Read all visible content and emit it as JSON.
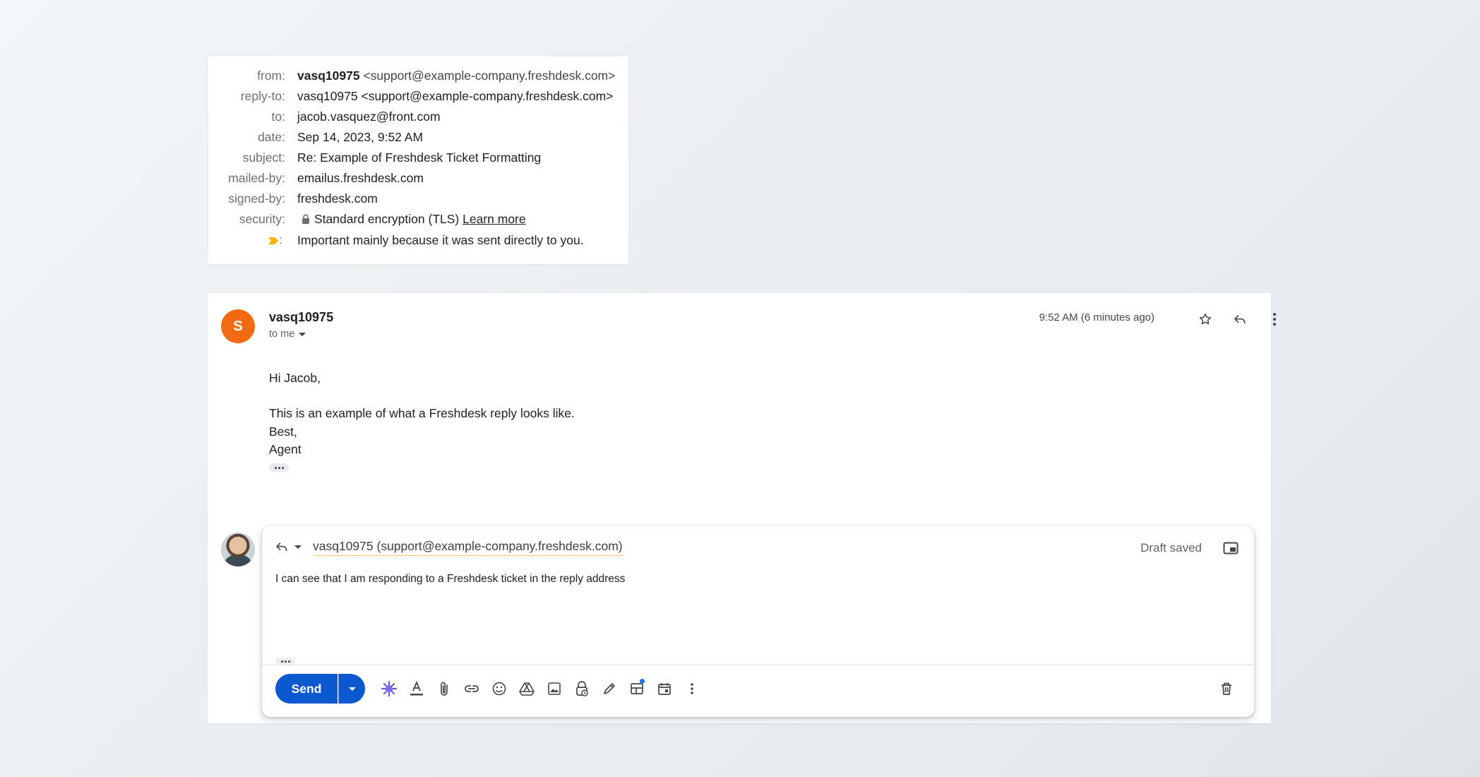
{
  "details": {
    "rows": [
      {
        "label": "from:",
        "name": "vasq10975",
        "address": "<support@example-company.freshdesk.com>"
      },
      {
        "label": "reply-to:",
        "value": "vasq10975 <support@example-company.freshdesk.com>"
      },
      {
        "label": "to:",
        "value": "jacob.vasquez@front.com"
      },
      {
        "label": "date:",
        "value": "Sep 14, 2023, 9:52 AM"
      },
      {
        "label": "subject:",
        "value": "Re: Example of Freshdesk Ticket Formatting"
      },
      {
        "label": "mailed-by:",
        "value": "emailus.freshdesk.com"
      },
      {
        "label": "signed-by:",
        "value": "freshdesk.com"
      },
      {
        "label": "security:",
        "value": "Standard encryption (TLS)",
        "link": "Learn more"
      },
      {
        "label": ":",
        "value": "Important mainly because it was sent directly to you."
      }
    ],
    "importance_color": "#f4b400"
  },
  "message": {
    "avatar_letter": "S",
    "avatar_color": "#f26b12",
    "sender": "vasq10975",
    "to_me": "to me",
    "time": "9:52 AM (6 minutes ago)",
    "body": [
      "Hi Jacob,",
      "This is an example of what a Freshdesk reply looks like.",
      "Best,",
      "Agent"
    ],
    "icons": [
      "star-icon",
      "reply-icon",
      "more-vert-icon"
    ]
  },
  "composer": {
    "recipient": "vasq10975 (support@example-company.freshdesk.com)",
    "draft_status": "Draft saved",
    "text": "I can see that I am responding to a Freshdesk ticket in the reply address",
    "send_label": "Send",
    "send_color": "#0b57d0",
    "toolbar_icons": [
      "gemini-icon",
      "formatting-icon",
      "attach-icon",
      "link-icon",
      "emoji-icon",
      "drive-icon",
      "photo-icon",
      "confidential-icon",
      "signature-icon",
      "layouts-icon",
      "schedule-icon",
      "more-options-icon",
      "trash-icon"
    ]
  }
}
